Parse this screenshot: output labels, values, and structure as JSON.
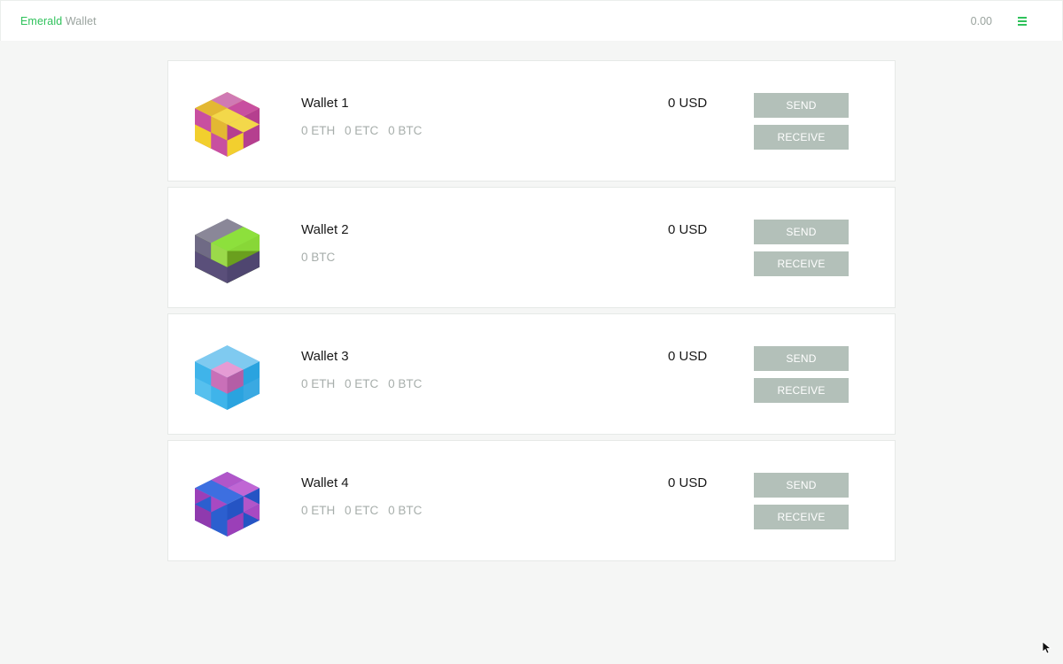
{
  "header": {
    "brand_primary": "Emerald",
    "brand_secondary": "Wallet",
    "total_balance": "0.00",
    "menu_icon": "hamburger-menu-icon"
  },
  "colors": {
    "brand_green": "#2fc25b",
    "muted_text": "#9aa39e",
    "button_bg": "#b3c0b9",
    "page_bg": "#f5f6f5"
  },
  "wallets": [
    {
      "name": "Wallet 1",
      "balances": [
        "0 ETH",
        "0 ETC",
        "0 BTC"
      ],
      "fiat": "0 USD",
      "send_label": "SEND",
      "receive_label": "RECEIVE",
      "avatar_icon": "identicon-cube-pink-yellow-icon"
    },
    {
      "name": "Wallet 2",
      "balances": [
        "0 BTC"
      ],
      "fiat": "0 USD",
      "send_label": "SEND",
      "receive_label": "RECEIVE",
      "avatar_icon": "identicon-cube-green-gray-icon"
    },
    {
      "name": "Wallet 3",
      "balances": [
        "0 ETH",
        "0 ETC",
        "0 BTC"
      ],
      "fiat": "0 USD",
      "send_label": "SEND",
      "receive_label": "RECEIVE",
      "avatar_icon": "identicon-cube-blue-pink-icon"
    },
    {
      "name": "Wallet 4",
      "balances": [
        "0 ETH",
        "0 ETC",
        "0 BTC"
      ],
      "fiat": "0 USD",
      "send_label": "SEND",
      "receive_label": "RECEIVE",
      "avatar_icon": "identicon-cube-blue-purple-icon"
    }
  ]
}
